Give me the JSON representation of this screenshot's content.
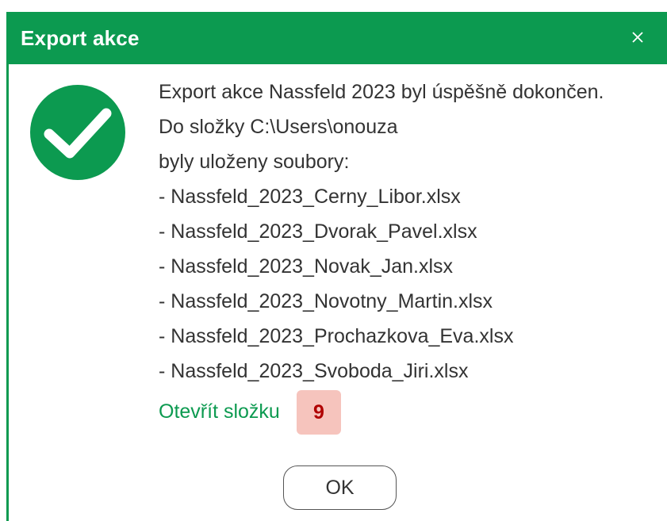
{
  "dialog": {
    "title": "Export akce",
    "close_icon": "close-icon",
    "status_icon": "check-circle-icon",
    "lines": [
      "Export akce Nassfeld 2023 byl úspěšně dokončen.",
      "Do složky C:\\Users\\onouza",
      "byly uloženy soubory:",
      "- Nassfeld_2023_Cerny_Libor.xlsx",
      "- Nassfeld_2023_Dvorak_Pavel.xlsx",
      "- Nassfeld_2023_Novak_Jan.xlsx",
      "- Nassfeld_2023_Novotny_Martin.xlsx",
      "- Nassfeld_2023_Prochazkova_Eva.xlsx",
      "- Nassfeld_2023_Svoboda_Jiri.xlsx"
    ],
    "open_folder_label": "Otevřít složku",
    "badge": "9",
    "ok_label": "OK"
  },
  "colors": {
    "accent": "#0c9a50",
    "badge_bg": "#f6c4bd",
    "badge_text": "#b00000"
  }
}
